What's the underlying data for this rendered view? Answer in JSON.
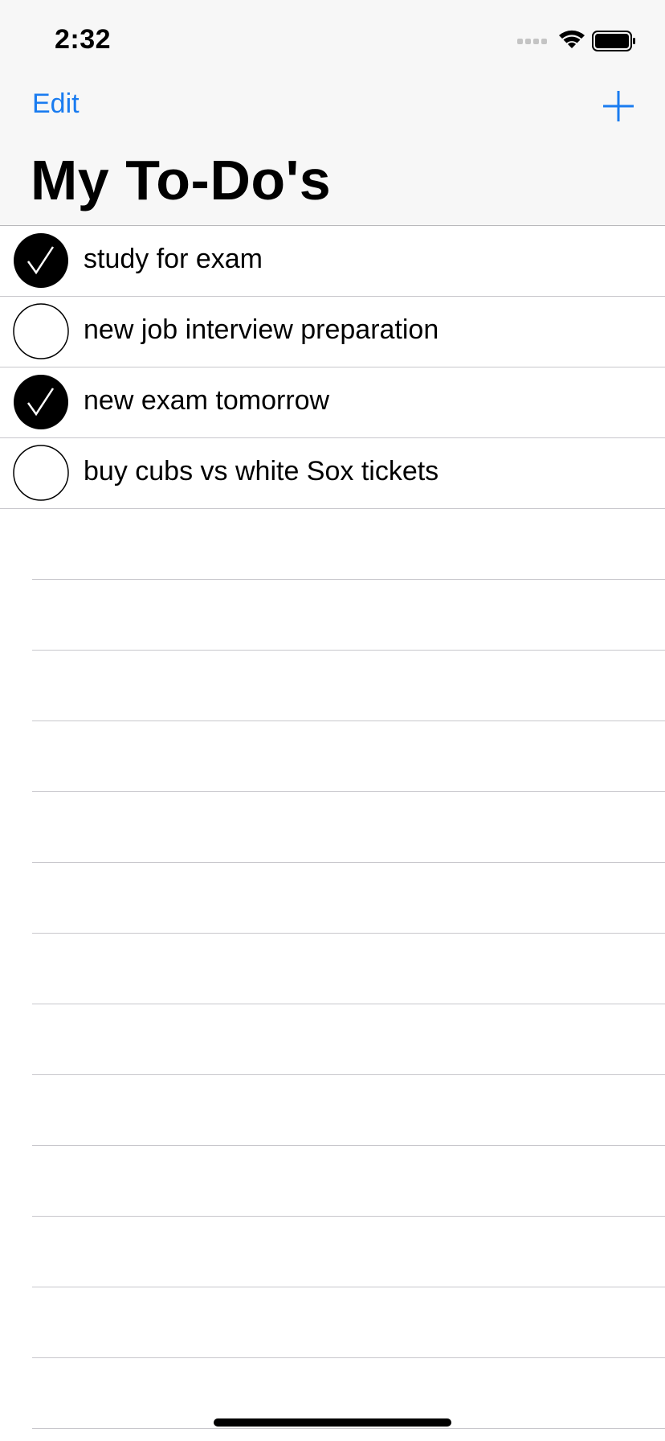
{
  "status_bar": {
    "time": "2:32",
    "icons": [
      "signal-dots-icon",
      "wifi-icon",
      "battery-icon"
    ]
  },
  "nav": {
    "edit_label": "Edit",
    "add_icon": "plus-icon",
    "title": "My To-Do's"
  },
  "colors": {
    "accent": "#1a7cf0",
    "separator": "#c8c7cc",
    "header_bg": "#f7f7f7"
  },
  "todos": [
    {
      "label": "study for exam",
      "done": true
    },
    {
      "label": "new job interview preparation",
      "done": false
    },
    {
      "label": "new exam tomorrow",
      "done": true
    },
    {
      "label": "buy cubs vs white Sox tickets",
      "done": false
    }
  ]
}
